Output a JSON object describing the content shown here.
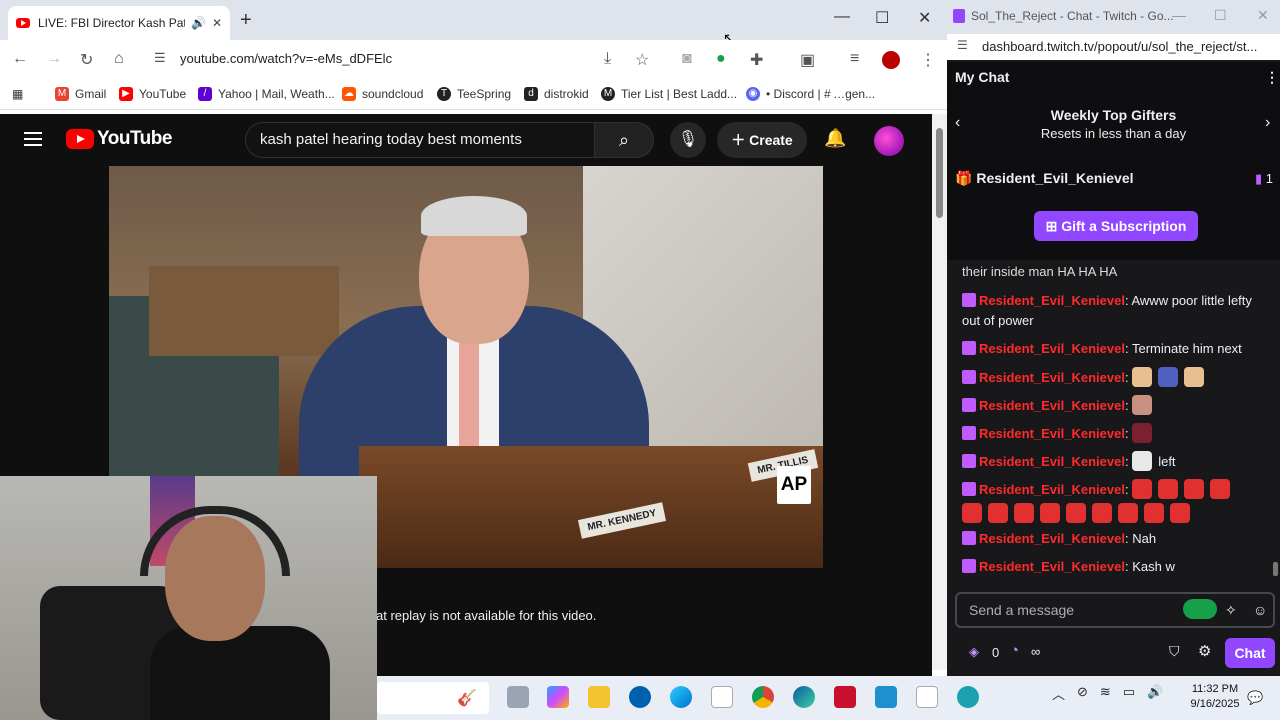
{
  "browser": {
    "tab_title": "LIVE: FBI Director Kash Pate",
    "url": "youtube.com/watch?v=-eMs_dDFElc",
    "bookmarks": [
      {
        "label": "Gmail",
        "color": "#ea4335"
      },
      {
        "label": "YouTube",
        "color": "#ff0000"
      },
      {
        "label": "Yahoo | Mail, Weath...",
        "color": "#6001d2"
      },
      {
        "label": "soundcloud",
        "color": "#ff5500"
      },
      {
        "label": "TeeSpring",
        "color": "#222222"
      },
      {
        "label": "distrokid",
        "color": "#222222"
      },
      {
        "label": "Tier List | Best Ladd...",
        "color": "#222222"
      },
      {
        "label": "• Discord | # …gen...",
        "color": "#5865f2"
      }
    ]
  },
  "youtube": {
    "logo_text": "YouTube",
    "search_query": "kash patel hearing today best moments",
    "create_label": "Create",
    "video": {
      "nameplate_1": "MR. TILLIS",
      "nameplate_2": "MR. KENNEDY",
      "watermark": "AP"
    },
    "chat_notice": "at replay is not available for this video."
  },
  "twitch": {
    "window_title": "Sol_The_Reject - Chat - Twitch - Go...",
    "url": "dashboard.twitch.tv/popout/u/sol_the_reject/st...",
    "panel_title": "My Chat",
    "gifters_title": "Weekly Top Gifters",
    "gifters_sub": "Resets in less than a day",
    "top_gifter": "Resident_Evil_Kenievel",
    "top_gifter_count": "1",
    "gift_button": "Gift a Subscription",
    "partial_line": "their inside man HA HA HA",
    "username": "Resident_Evil_Kenievel",
    "messages": [
      {
        "text": "Awww poor little lefty out of power"
      },
      {
        "text": "Terminate him next"
      },
      {
        "text": ""
      },
      {
        "text": ""
      },
      {
        "text": ""
      },
      {
        "text": "left"
      },
      {
        "text": ""
      },
      {
        "text": "Nah"
      },
      {
        "text": "Kash w"
      }
    ],
    "input_placeholder": "Send a message",
    "points": "0",
    "infinity": "∞",
    "chat_button": "Chat"
  },
  "taskbar": {
    "time": "11:32 PM",
    "date": "9/16/2025"
  },
  "colors": {
    "twitch_purple": "#9147ff",
    "youtube_red": "#ff0000"
  }
}
